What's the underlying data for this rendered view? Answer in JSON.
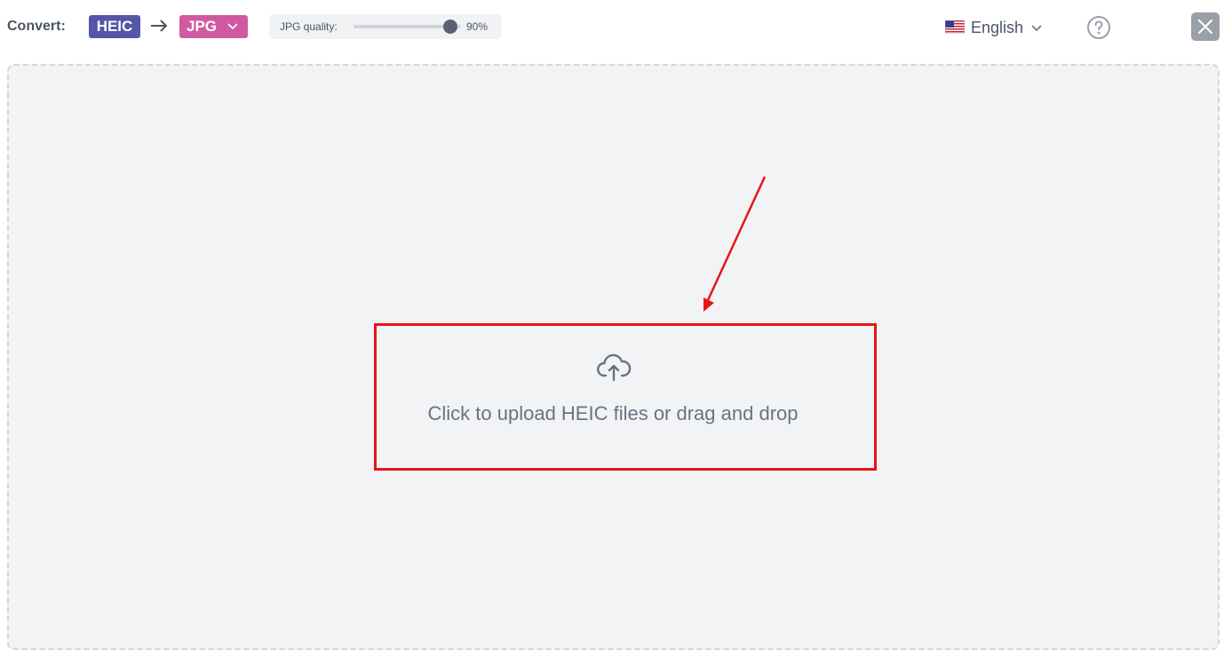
{
  "toolbar": {
    "convert_label": "Convert:",
    "from_format": "HEIC",
    "to_format": "JPG",
    "quality_label": "JPG quality:",
    "quality_value": "90%",
    "quality_percent": 90,
    "language": "English",
    "language_flag_icon": "us-flag-icon",
    "help_icon": "question-circle-icon",
    "close_icon": "close-icon"
  },
  "colors": {
    "from_badge": "#5456a8",
    "to_badge": "#cf5aa2",
    "dropzone_bg": "#f2f3f5",
    "annotation": "#e8141b"
  },
  "dropzone": {
    "icon": "cloud-upload-icon",
    "text": "Click to upload HEIC files or drag and drop"
  }
}
